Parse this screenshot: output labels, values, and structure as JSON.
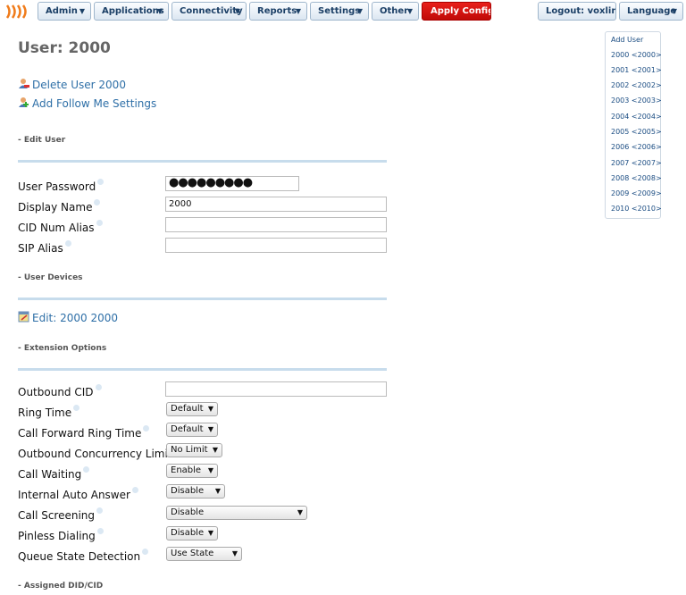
{
  "nav": {
    "admin": "Admin",
    "applications": "Applications",
    "connectivity": "Connectivity",
    "reports": "Reports",
    "settings": "Settings",
    "other": "Other",
    "apply_config": "Apply Config",
    "logout": "Logout: voxlink",
    "language": "Language"
  },
  "page": {
    "title": "User: 2000",
    "delete_link": "Delete User 2000",
    "follow_me_link": "Add Follow Me Settings"
  },
  "sections": {
    "edit_user": "- Edit User",
    "user_devices": "- User Devices",
    "extension_options": "- Extension Options",
    "assigned_did": "- Assigned DID/CID"
  },
  "edit_user": {
    "password_label": "User Password",
    "password_value": "●●●●●●●●●",
    "display_name_label": "Display Name",
    "display_name_value": "2000",
    "cid_alias_label": "CID Num Alias",
    "cid_alias_value": "",
    "sip_alias_label": "SIP Alias",
    "sip_alias_value": ""
  },
  "devices": {
    "edit_link": "Edit: 2000 2000"
  },
  "extension_options": {
    "outbound_cid_label": "Outbound CID",
    "outbound_cid_value": "",
    "ring_time_label": "Ring Time",
    "ring_time_value": "Default",
    "cf_ring_time_label": "Call Forward Ring Time",
    "cf_ring_time_value": "Default",
    "concurrency_label": "Outbound Concurrency Limit",
    "concurrency_value": "No Limit",
    "call_waiting_label": "Call Waiting",
    "call_waiting_value": "Enable",
    "auto_answer_label": "Internal Auto Answer",
    "auto_answer_value": "Disable",
    "call_screening_label": "Call Screening",
    "call_screening_value": "Disable",
    "pinless_label": "Pinless Dialing",
    "pinless_value": "Disable",
    "queue_state_label": "Queue State Detection",
    "queue_state_value": "Use State"
  },
  "sidebar": {
    "items": [
      "Add User",
      "2000 <2000>",
      "2001 <2001>",
      "2002 <2002>",
      "2003 <2003>",
      "2004 <2004>",
      "2005 <2005>",
      "2006 <2006>",
      "2007 <2007>",
      "2008 <2008>",
      "2009 <2009>",
      "2010 <2010>"
    ]
  },
  "colors": {
    "link": "#2e6fa7",
    "apply_button": "#d0100c",
    "nav_text": "#1b3f66",
    "section_rule": "#c7dcec"
  }
}
